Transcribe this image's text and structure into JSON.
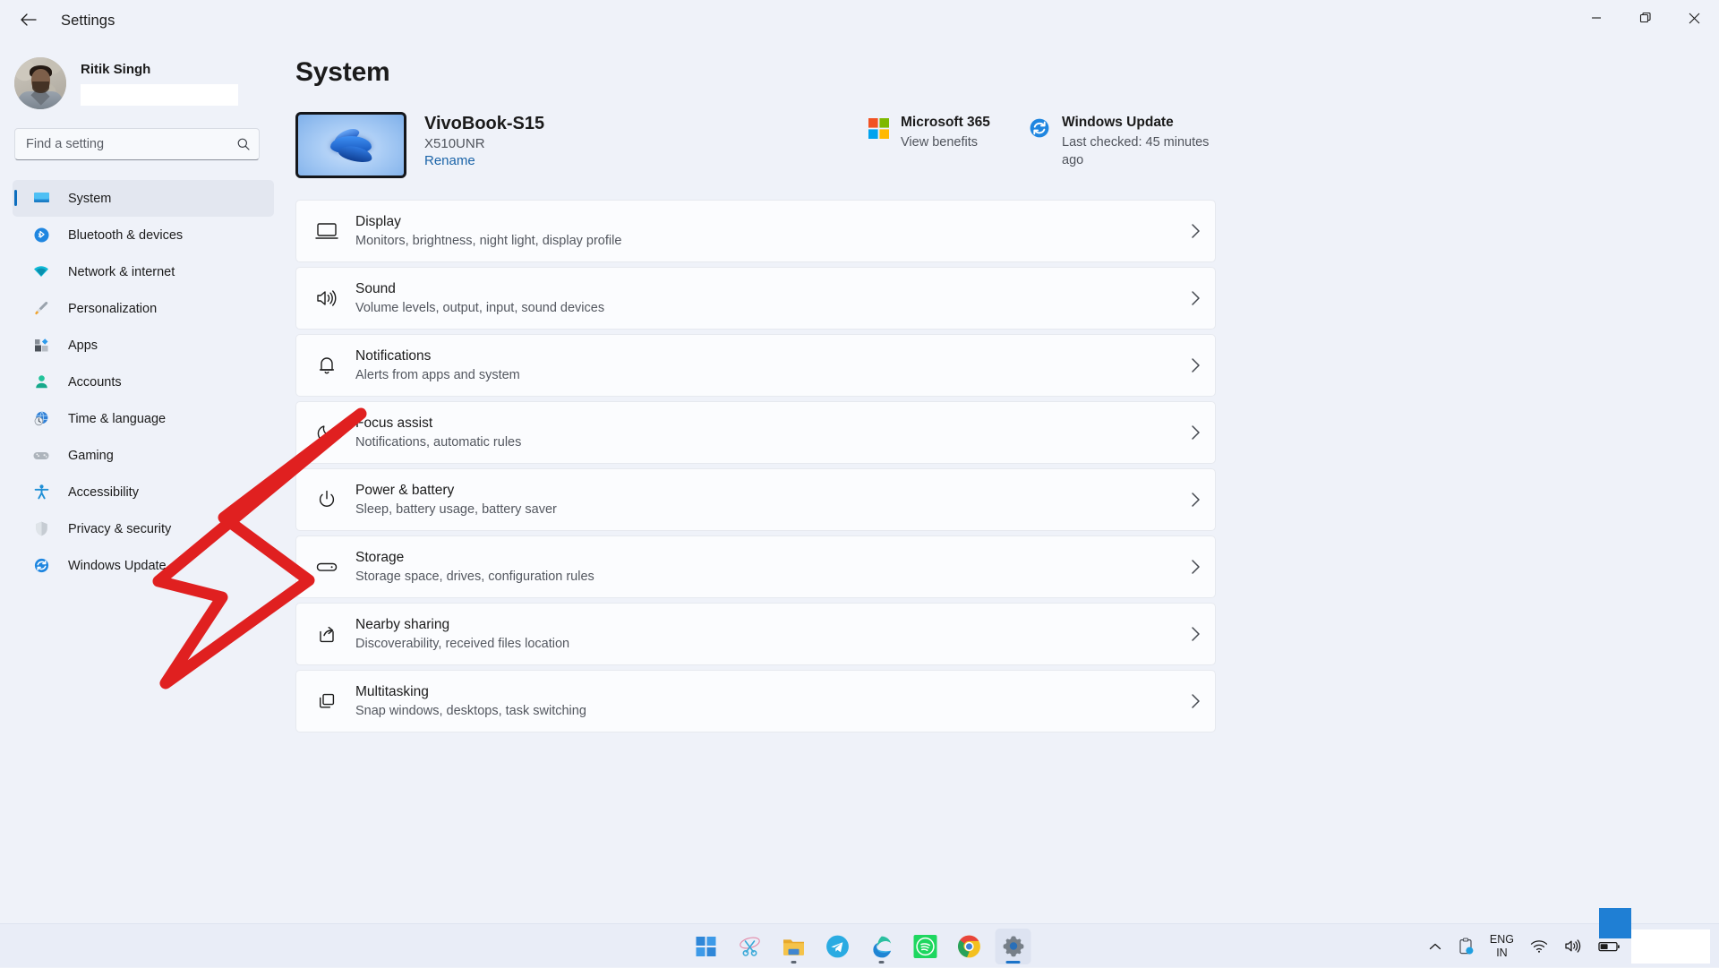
{
  "window": {
    "title": "Settings",
    "back_icon": "back-arrow-icon",
    "controls": {
      "minimize": "minimize-icon",
      "maximize": "maximize-icon",
      "close": "close-icon"
    }
  },
  "sidebar": {
    "profile": {
      "name": "Ritik Singh",
      "email_redacted": true
    },
    "search": {
      "placeholder": "Find a setting",
      "value": "",
      "icon": "search-icon"
    },
    "items": [
      {
        "label": "System",
        "icon": "monitor-icon",
        "active": true
      },
      {
        "label": "Bluetooth & devices",
        "icon": "bluetooth-icon",
        "active": false
      },
      {
        "label": "Network & internet",
        "icon": "wifi-icon",
        "active": false
      },
      {
        "label": "Personalization",
        "icon": "paintbrush-icon",
        "active": false
      },
      {
        "label": "Apps",
        "icon": "apps-grid-icon",
        "active": false
      },
      {
        "label": "Accounts",
        "icon": "person-icon",
        "active": false
      },
      {
        "label": "Time & language",
        "icon": "clock-globe-icon",
        "active": false
      },
      {
        "label": "Gaming",
        "icon": "gamepad-icon",
        "active": false
      },
      {
        "label": "Accessibility",
        "icon": "accessibility-person-icon",
        "active": false
      },
      {
        "label": "Privacy & security",
        "icon": "shield-icon",
        "active": false
      },
      {
        "label": "Windows Update",
        "icon": "update-refresh-icon",
        "active": false
      }
    ]
  },
  "main": {
    "page_title": "System",
    "device": {
      "name": "VivoBook-S15",
      "model": "X510UNR",
      "rename_label": "Rename",
      "thumbnail": "windows-bloom-wallpaper"
    },
    "cards": [
      {
        "title": "Microsoft 365",
        "subtitle": "View benefits",
        "icon": "microsoft-logo-icon"
      },
      {
        "title": "Windows Update",
        "subtitle": "Last checked: 45 minutes ago",
        "icon": "windows-update-refresh-icon"
      }
    ],
    "settings_rows": [
      {
        "title": "Display",
        "subtitle": "Monitors, brightness, night light, display profile",
        "icon": "display-monitor-icon"
      },
      {
        "title": "Sound",
        "subtitle": "Volume levels, output, input, sound devices",
        "icon": "speaker-icon"
      },
      {
        "title": "Notifications",
        "subtitle": "Alerts from apps and system",
        "icon": "bell-icon"
      },
      {
        "title": "Focus assist",
        "subtitle": "Notifications, automatic rules",
        "icon": "moon-icon"
      },
      {
        "title": "Power & battery",
        "subtitle": "Sleep, battery usage, battery saver",
        "icon": "power-icon"
      },
      {
        "title": "Storage",
        "subtitle": "Storage space, drives, configuration rules",
        "icon": "drive-icon"
      },
      {
        "title": "Nearby sharing",
        "subtitle": "Discoverability, received files location",
        "icon": "share-icon"
      },
      {
        "title": "Multitasking",
        "subtitle": "Snap windows, desktops, task switching",
        "icon": "windows-stack-icon"
      }
    ]
  },
  "annotation": {
    "type": "red-arrow",
    "color": "#e02020",
    "points_at": "Notifications"
  },
  "taskbar": {
    "apps": [
      {
        "name": "start-button",
        "icon": "windows-start-icon",
        "state": "idle"
      },
      {
        "name": "snipping-tool",
        "icon": "scissors-icon",
        "state": "idle"
      },
      {
        "name": "file-explorer",
        "icon": "folder-icon",
        "state": "running"
      },
      {
        "name": "telegram",
        "icon": "telegram-icon",
        "state": "idle"
      },
      {
        "name": "microsoft-edge",
        "icon": "edge-icon",
        "state": "running"
      },
      {
        "name": "spotify",
        "icon": "spotify-icon",
        "state": "idle"
      },
      {
        "name": "google-chrome",
        "icon": "chrome-icon",
        "state": "idle"
      },
      {
        "name": "settings",
        "icon": "gear-icon",
        "state": "active"
      }
    ],
    "tray": {
      "overflow_icon": "chevron-up-icon",
      "onedrive_icon": "onedrive-sync-icon",
      "language": {
        "line1": "ENG",
        "line2": "IN"
      },
      "wifi_icon": "wifi-icon",
      "volume_icon": "volume-icon",
      "battery_icon": "battery-icon",
      "clock_redacted": true
    }
  },
  "colors": {
    "accent": "#0d6ebe",
    "window_bg": "#eff2f9",
    "card_bg": "#fbfcfe",
    "taskbar_bg": "#e9edf7",
    "annotation_red": "#e02020",
    "link_blue": "#1b64a8"
  }
}
